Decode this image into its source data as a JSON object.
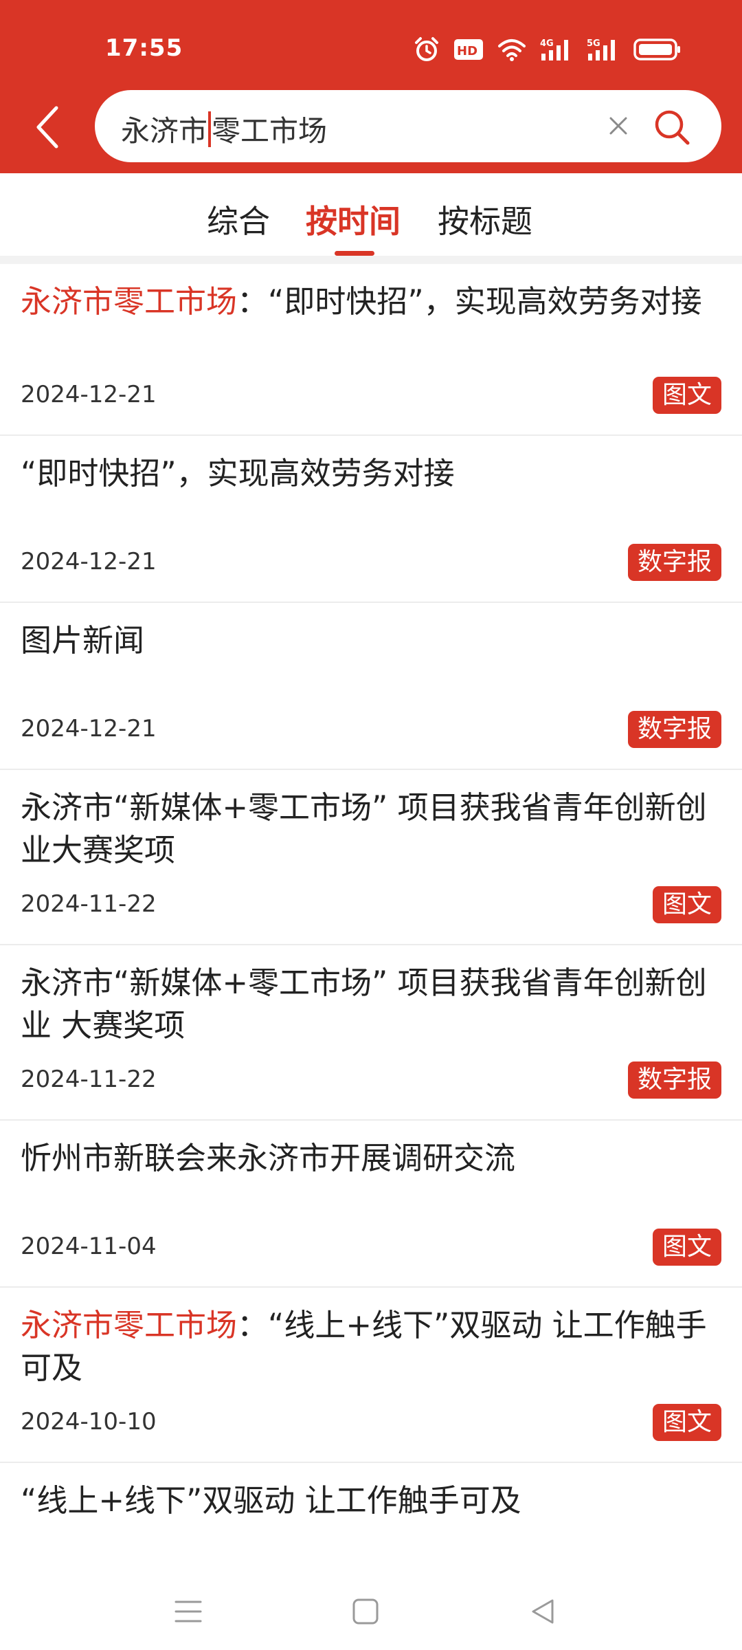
{
  "status_bar": {
    "time": "17:55",
    "icons": [
      "alarm-icon",
      "hd-voice-icon",
      "wifi-icon",
      "signal-4g-icon",
      "signal-5g-icon",
      "battery-icon"
    ],
    "hd_label": "HD",
    "net_4g": "4G",
    "net_5g": "5G"
  },
  "search": {
    "query_before_caret": "永济市",
    "query_after_caret": "零工市场"
  },
  "tabs": [
    {
      "label": "综合",
      "active": false
    },
    {
      "label": "按时间",
      "active": true
    },
    {
      "label": "按标题",
      "active": false
    }
  ],
  "results": [
    {
      "highlight": "永济市零工市场",
      "title": "：“即时快招”，实现高效劳务对接",
      "date": "2024-12-21",
      "badge": "图文"
    },
    {
      "highlight": "",
      "title": "“即时快招”，实现高效劳务对接",
      "date": "2024-12-21",
      "badge": "数字报"
    },
    {
      "highlight": "",
      "title": "图片新闻",
      "date": "2024-12-21",
      "badge": "数字报"
    },
    {
      "highlight": "",
      "title": "永济市“新媒体+零工市场” 项目获我省青年创新创业大赛奖项",
      "date": "2024-11-22",
      "badge": "图文"
    },
    {
      "highlight": "",
      "title": "永济市“新媒体+零工市场” 项目获我省青年创新创业 大赛奖项",
      "date": "2024-11-22",
      "badge": "数字报"
    },
    {
      "highlight": "",
      "title": "忻州市新联会来永济市开展调研交流",
      "date": "2024-11-04",
      "badge": "图文"
    },
    {
      "highlight": "永济市零工市场",
      "title": "：“线上+线下”双驱动 让工作触手可及",
      "date": "2024-10-10",
      "badge": "图文"
    },
    {
      "highlight": "",
      "title": "“线上+线下”双驱动 让工作触手可及",
      "date": "",
      "badge": ""
    }
  ],
  "colors": {
    "accent": "#d93526",
    "text": "#222222",
    "divider": "#ececec"
  },
  "navbar": {
    "icons": [
      "menu-icon",
      "home-square-icon",
      "back-triangle-icon"
    ]
  }
}
